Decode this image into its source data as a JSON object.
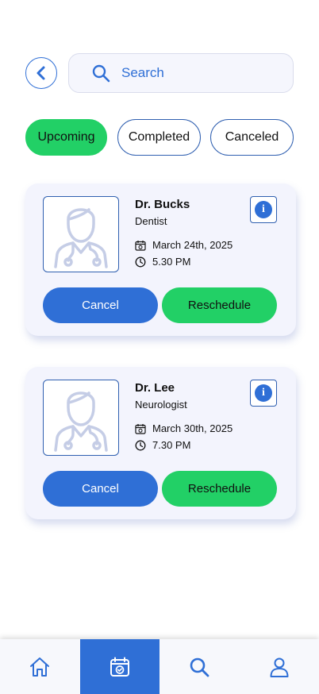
{
  "search": {
    "placeholder": "Search"
  },
  "tabs": [
    {
      "label": "Upcoming",
      "active": true
    },
    {
      "label": "Completed",
      "active": false
    },
    {
      "label": "Canceled",
      "active": false
    }
  ],
  "appointments": [
    {
      "doctor": "Dr. Bucks",
      "specialty": "Dentist",
      "date": "March 24th, 2025",
      "time": "5.30 PM",
      "cancel_label": "Cancel",
      "reschedule_label": "Reschedule"
    },
    {
      "doctor": "Dr. Lee",
      "specialty": "Neurologist",
      "date": "March 30th, 2025",
      "time": "7.30 PM",
      "cancel_label": "Cancel",
      "reschedule_label": "Reschedule"
    }
  ],
  "info_icon_glyph": "i",
  "nav": [
    {
      "icon": "home-icon",
      "active": false
    },
    {
      "icon": "calendar-icon",
      "active": true
    },
    {
      "icon": "search-icon",
      "active": false
    },
    {
      "icon": "profile-icon",
      "active": false
    }
  ],
  "colors": {
    "primary": "#2f6fd6",
    "accent": "#22d066",
    "card_bg": "#f3f4fd"
  }
}
